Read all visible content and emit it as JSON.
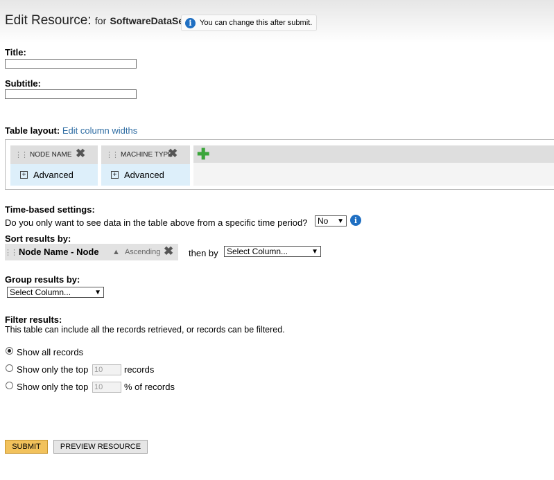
{
  "header": {
    "title": "Edit Resource:",
    "for_label": "for",
    "dataset_name": "SoftwareDataSet",
    "hint_text": "You can change this after submit.",
    "hint_icon": "info-icon"
  },
  "fields": {
    "title_label": "Title:",
    "title_value": "",
    "subtitle_label": "Subtitle:",
    "subtitle_value": ""
  },
  "table_layout": {
    "label": "Table layout:",
    "edit_link": "Edit column widths",
    "columns": [
      {
        "name": "NODE NAME",
        "advanced_label": "Advanced"
      },
      {
        "name": "MACHINE TYPE",
        "advanced_label": "Advanced"
      }
    ],
    "add_icon": "plus-icon",
    "remove_icon": "close-icon"
  },
  "time_settings": {
    "label": "Time-based settings:",
    "question": "Do you only want to see data in the table above from a specific time period?",
    "selected": "No"
  },
  "sort": {
    "label": "Sort results by:",
    "column": "Node Name - Node",
    "direction": "Ascending",
    "then_by_label": "then by",
    "then_by_selected": "Select Column..."
  },
  "group": {
    "label": "Group results by:",
    "selected": "Select Column..."
  },
  "filter": {
    "label": "Filter results:",
    "description": "This table can include all the records retrieved, or records can be filtered.",
    "options": [
      {
        "label": "Show all records",
        "checked": true
      },
      {
        "label": "Show only the top",
        "value": "10",
        "suffix": "records",
        "checked": false
      },
      {
        "label": "Show only the top",
        "value": "10",
        "suffix": "% of records",
        "checked": false
      }
    ]
  },
  "buttons": {
    "submit": "SUBMIT",
    "preview": "PREVIEW RESOURCE"
  },
  "colors": {
    "link": "#2f6da3",
    "submit_bg": "#f2c25c",
    "column_bg": "#ddeffa",
    "info_icon": "#1f6fc2",
    "add_icon": "#3aa53a"
  }
}
